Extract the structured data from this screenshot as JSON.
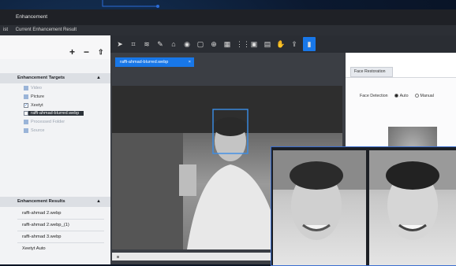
{
  "window": {
    "title": "Enhancement",
    "menu": [
      "ist",
      "Current Enhancement Result"
    ]
  },
  "left_panel": {
    "targets_header": "Enhancement Targets",
    "target_items": [
      {
        "label": "Video",
        "dim": true
      },
      {
        "label": "Picture",
        "dim": false
      },
      {
        "label": "Xeetyt",
        "dim": false,
        "checked": true
      },
      {
        "label": "raffi-ahmad-blurred.webp",
        "dim": false,
        "selected": true
      },
      {
        "label": "Processed Folder",
        "dim": true
      },
      {
        "label": "Source",
        "dim": true
      }
    ],
    "results_header": "Enhancement Results",
    "result_items": [
      "raffi-ahmad 2.webp",
      "raffi-ahmad 2.webp_(1)",
      "raffi-ahmad 3.webp",
      "Xeetyt Auto"
    ]
  },
  "editor": {
    "tab_label": "raffi-ahmad-blurred.webp",
    "tab_close": "×"
  },
  "right_panel": {
    "tab_label": "Face Restoration",
    "face_detection_label": "Face Detection",
    "options": [
      "Auto",
      "Manual"
    ],
    "selected": "Auto"
  },
  "toolbar": {
    "icons": [
      "pointer-icon",
      "crop-icon",
      "adjust-icon",
      "lasso-icon",
      "stamp-icon",
      "target-icon",
      "frame-icon",
      "layers-icon",
      "grid-icon",
      "mosaic-icon",
      "image-icon",
      "compare-icon",
      "hand-icon",
      "export-icon",
      "save-icon"
    ],
    "glyphs": [
      "➤",
      "⌗",
      "≋",
      "✎",
      "⌂",
      "◉",
      "▢",
      "⊕",
      "▦",
      "⋮⋮",
      "▣",
      "▤",
      "✋",
      "⇪",
      "▮"
    ]
  },
  "colors": {
    "accent": "#1877e8",
    "panel": "#f2f3f5",
    "dark": "#2a2d33"
  }
}
